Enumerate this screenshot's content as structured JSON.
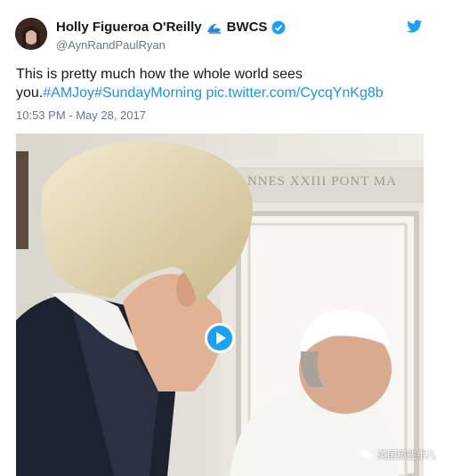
{
  "author": {
    "display_name": "Holly Figueroa O'Reilly",
    "suffix": "BWCS",
    "handle": "@AynRandPaulRyan",
    "verified": true
  },
  "tweet": {
    "text_line1": "This is pretty much how the whole world sees",
    "text_you": "you.",
    "hashtag1": "#AMJoy",
    "hashtag2": "#SundayMorning",
    "link": "pic.twitter.com/CycqYnKg8b",
    "timestamp": "10:53 PM - May 28, 2017"
  },
  "media": {
    "inscription": "ANNES XXIII PONT MA",
    "watermark": "英国那些事儿"
  },
  "colors": {
    "link": "#1b95e0",
    "twitter_blue": "#1da1f2",
    "muted": "#657786"
  },
  "icons": [
    "wave-icon",
    "verified-badge-icon",
    "twitter-bird-icon",
    "play-icon",
    "wechat-icon"
  ]
}
